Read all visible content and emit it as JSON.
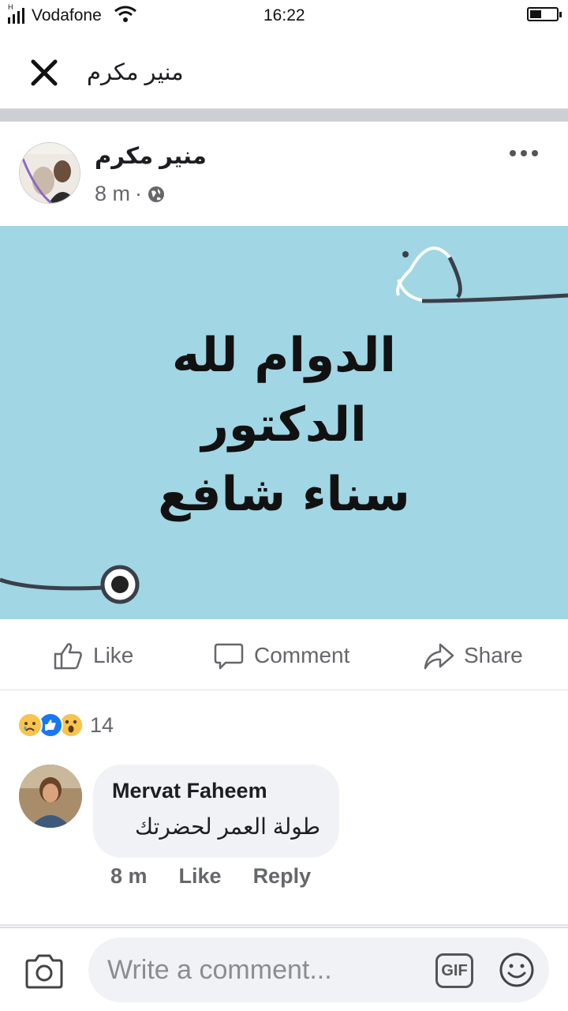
{
  "status_bar": {
    "network": "H",
    "carrier": "Vodafone",
    "time": "16:22",
    "battery_level": 0.45
  },
  "header": {
    "title": "منير مكرم"
  },
  "post": {
    "author_name": "منير مكرم",
    "time_ago": "8 m",
    "privacy_icon": "globe-icon",
    "image_text": [
      "الدوام لله",
      "الدكتور",
      "سناء شافع"
    ],
    "image_bg_color": "#a1d6e4"
  },
  "actions": {
    "like": "Like",
    "comment": "Comment",
    "share": "Share"
  },
  "reactions": {
    "types": [
      "sad",
      "like",
      "wow"
    ],
    "count": "14"
  },
  "comment": {
    "author": "Mervat Faheem",
    "text": "طولة العمر لحضرتك",
    "time": "8 m",
    "like": "Like",
    "reply": "Reply"
  },
  "composer": {
    "placeholder": "Write a comment...",
    "gif_label": "GIF"
  }
}
